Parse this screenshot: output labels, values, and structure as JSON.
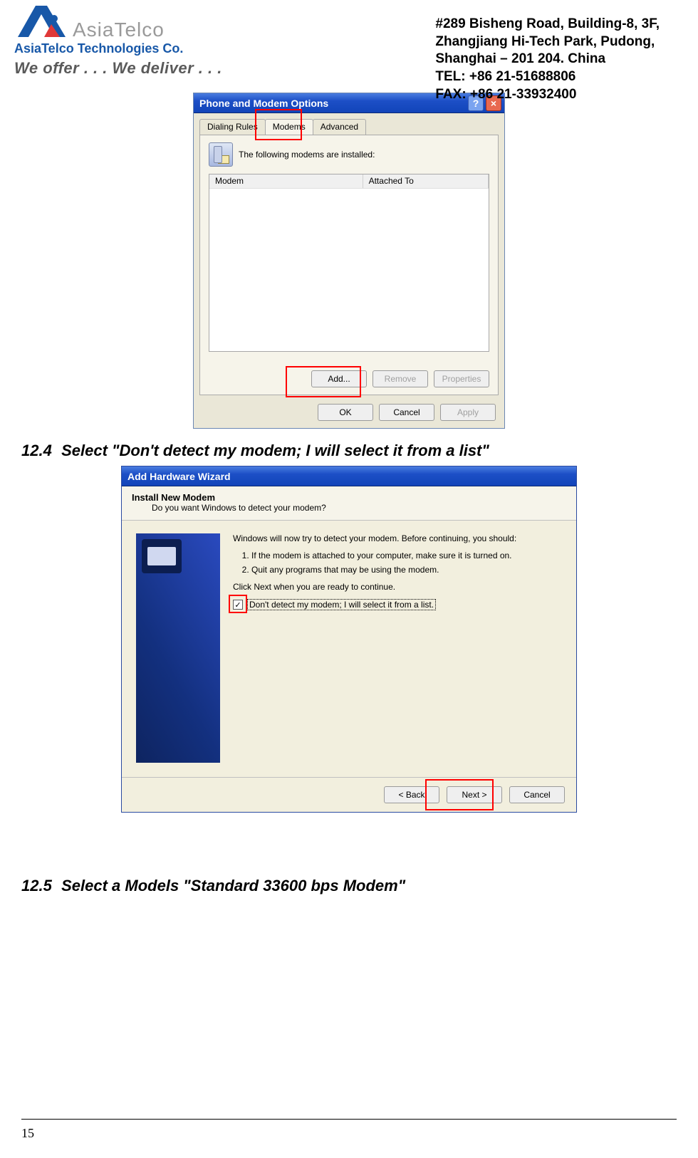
{
  "header": {
    "brand_asia": "AsiaTelco",
    "brand_sub": "AsiaTelco Technologies Co.",
    "tagline": "We offer . . . We deliver . . .",
    "addr1": "#289 Bisheng Road, Building-8, 3F,",
    "addr2": "Zhangjiang Hi-Tech Park, Pudong,",
    "addr3": "Shanghai – 201 204. China",
    "tel": "TEL: +86 21-51688806",
    "fax": "FAX: +86 21-33932400"
  },
  "sections": {
    "s124_num": "12.4",
    "s124_txt": "Select \"Don't detect my modem; I will select it from a list\"",
    "s125_num": "12.5",
    "s125_txt": "Select a Models \"Standard 33600 bps Modem\""
  },
  "dlg1": {
    "title": "Phone and Modem Options",
    "help_glyph": "?",
    "close_glyph": "×",
    "tabs": {
      "dialing": "Dialing Rules",
      "modems": "Modems",
      "advanced": "Advanced"
    },
    "label": "The following modems are  installed:",
    "cols": {
      "modem": "Modem",
      "att": "Attached To"
    },
    "buttons": {
      "add": "Add...",
      "remove": "Remove",
      "props": "Properties"
    },
    "foot": {
      "ok": "OK",
      "cancel": "Cancel",
      "apply": "Apply"
    }
  },
  "dlg2": {
    "title": "Add Hardware Wizard",
    "h1": "Install New Modem",
    "h2": "Do you want Windows to detect your modem?",
    "p_intro": "Windows will now try to detect your modem.  Before continuing, you should:",
    "li1": "If the modem is attached to your computer, make sure it is turned on.",
    "li2": "Quit any programs that may be using the modem.",
    "p_click": "Click Next when you are ready to continue.",
    "chk_mark": "✓",
    "chk_label": "Don't detect my modem; I will select it from a list.",
    "foot": {
      "back": "< Back",
      "next": "Next >",
      "cancel": "Cancel"
    }
  },
  "page_number": "15"
}
